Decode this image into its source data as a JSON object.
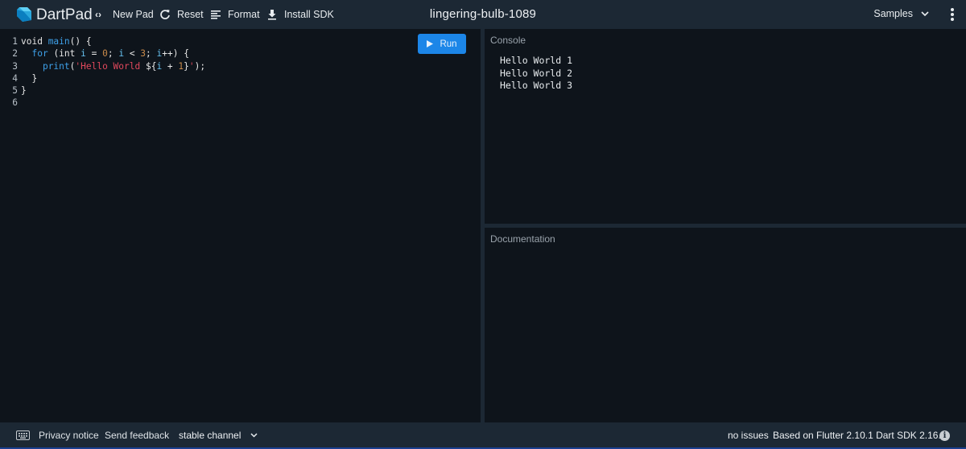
{
  "header": {
    "app_name": "DartPad",
    "new_pad": "New Pad",
    "reset": "Reset",
    "format": "Format",
    "install_sdk": "Install SDK",
    "pad_title": "lingering-bulb-1089",
    "samples": "Samples"
  },
  "editor": {
    "run_label": "Run",
    "line_numbers": [
      "1",
      "2",
      "3",
      "4",
      "5",
      "6"
    ]
  },
  "console": {
    "title": "Console",
    "lines": [
      "Hello World 1",
      "Hello World 2",
      "Hello World 3"
    ]
  },
  "documentation": {
    "title": "Documentation"
  },
  "footer": {
    "privacy": "Privacy notice",
    "feedback": "Send feedback",
    "channel": "stable channel",
    "issues": "no issues",
    "sdk_info": "Based on Flutter 2.10.1 Dart SDK 2.16.1",
    "info_glyph": "i"
  },
  "colors": {
    "header_bg": "#1c2834",
    "editor_bg": "#0e141b",
    "run_button": "#1c86e8",
    "keyword": "#3ea0e8",
    "string": "#e0485c",
    "number": "#c98a4a"
  },
  "icons": [
    "dart-logo-icon",
    "code-brackets-icon",
    "refresh-icon",
    "format-lines-icon",
    "download-icon",
    "chevron-down-icon",
    "more-vert-icon",
    "play-icon",
    "keyboard-icon",
    "info-icon"
  ]
}
